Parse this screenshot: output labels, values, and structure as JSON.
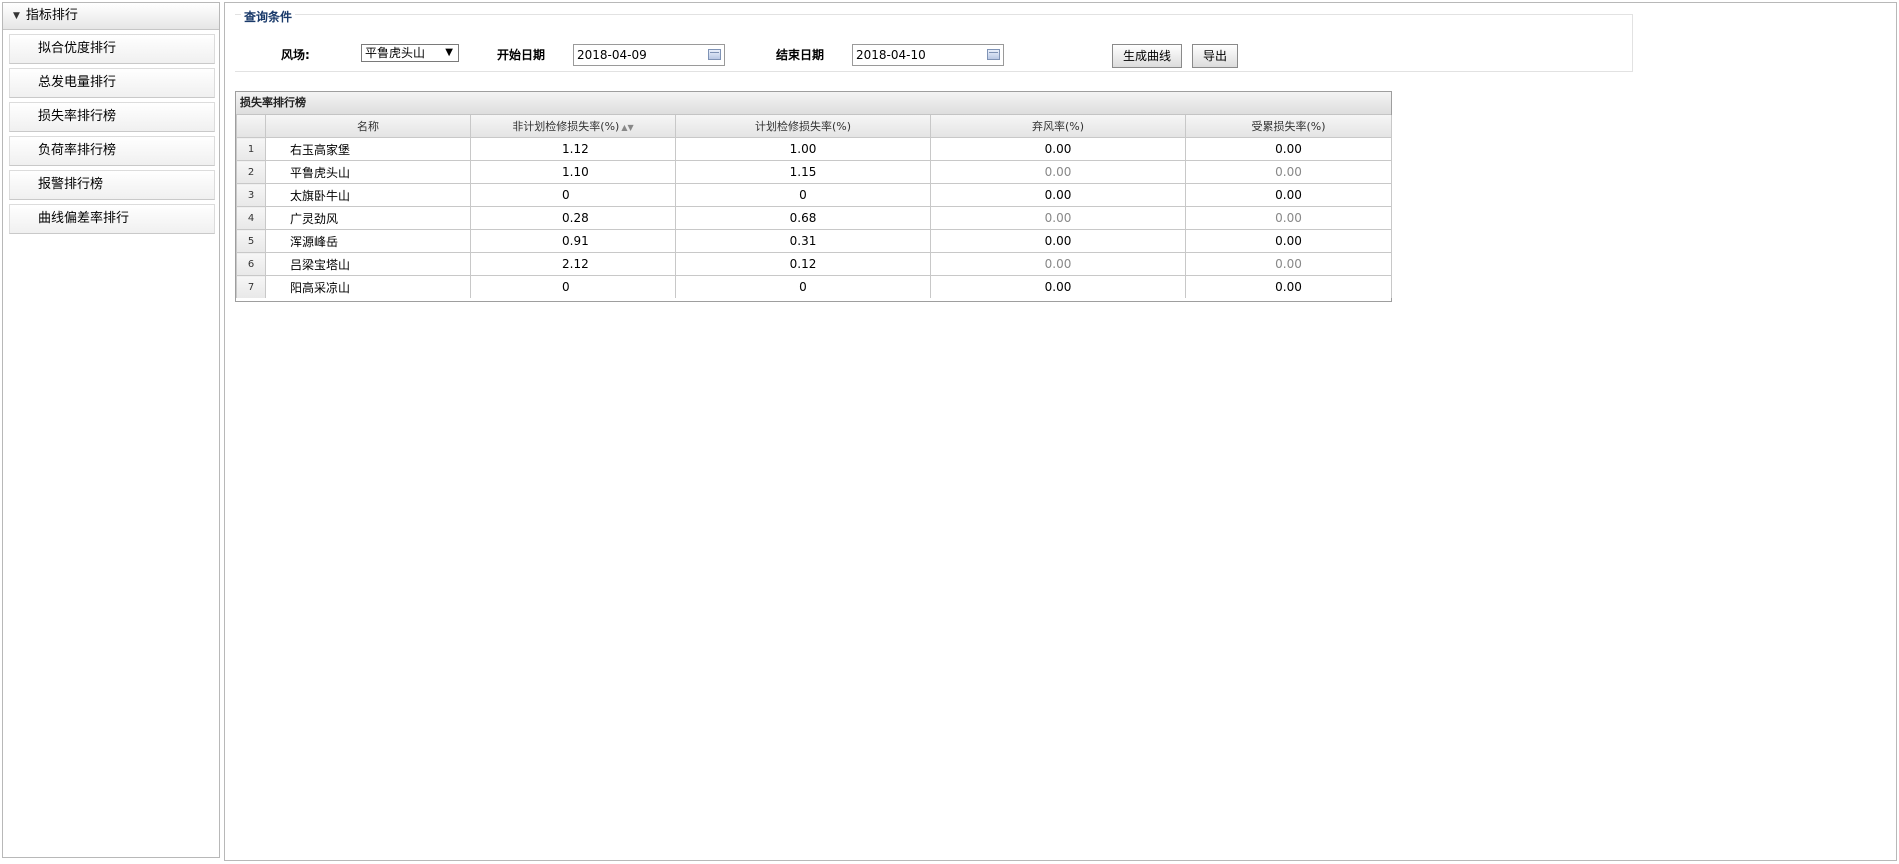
{
  "sidebar": {
    "header": "指标排行",
    "items": [
      {
        "label": "拟合优度排行"
      },
      {
        "label": "总发电量排行"
      },
      {
        "label": "损失率排行榜"
      },
      {
        "label": "负荷率排行榜"
      },
      {
        "label": "报警排行榜"
      },
      {
        "label": "曲线偏差率排行"
      }
    ]
  },
  "query": {
    "title": "查询条件",
    "wind_farm_label": "风场:",
    "wind_farm_value": "平鲁虎头山",
    "start_label": "开始日期",
    "start_value": "2018-04-09",
    "end_label": "结束日期",
    "end_value": "2018-04-10",
    "generate_label": "生成曲线",
    "export_label": "导出"
  },
  "table": {
    "title": "损失率排行榜",
    "columns": [
      "名称",
      "非计划检修损失率(%)",
      "计划检修损失率(%)",
      "弃风率(%)",
      "受累损失率(%)"
    ],
    "rows": [
      {
        "rank": "1",
        "name": "右玉高家堡",
        "unplanned": "1.12",
        "planned": "1.00",
        "curtail": "0.00",
        "affected": "0.00"
      },
      {
        "rank": "2",
        "name": "平鲁虎头山",
        "unplanned": "1.10",
        "planned": "1.15",
        "curtail": "0.00",
        "affected": "0.00"
      },
      {
        "rank": "3",
        "name": "太旗卧牛山",
        "unplanned": "0",
        "planned": "0",
        "curtail": "0.00",
        "affected": "0.00"
      },
      {
        "rank": "4",
        "name": "广灵劲风",
        "unplanned": "0.28",
        "planned": "0.68",
        "curtail": "0.00",
        "affected": "0.00"
      },
      {
        "rank": "5",
        "name": "浑源峰岳",
        "unplanned": "0.91",
        "planned": "0.31",
        "curtail": "0.00",
        "affected": "0.00"
      },
      {
        "rank": "6",
        "name": "吕梁宝塔山",
        "unplanned": "2.12",
        "planned": "0.12",
        "curtail": "0.00",
        "affected": "0.00"
      },
      {
        "rank": "7",
        "name": "阳高采凉山",
        "unplanned": "0",
        "planned": "0",
        "curtail": "0.00",
        "affected": "0.00"
      }
    ]
  }
}
